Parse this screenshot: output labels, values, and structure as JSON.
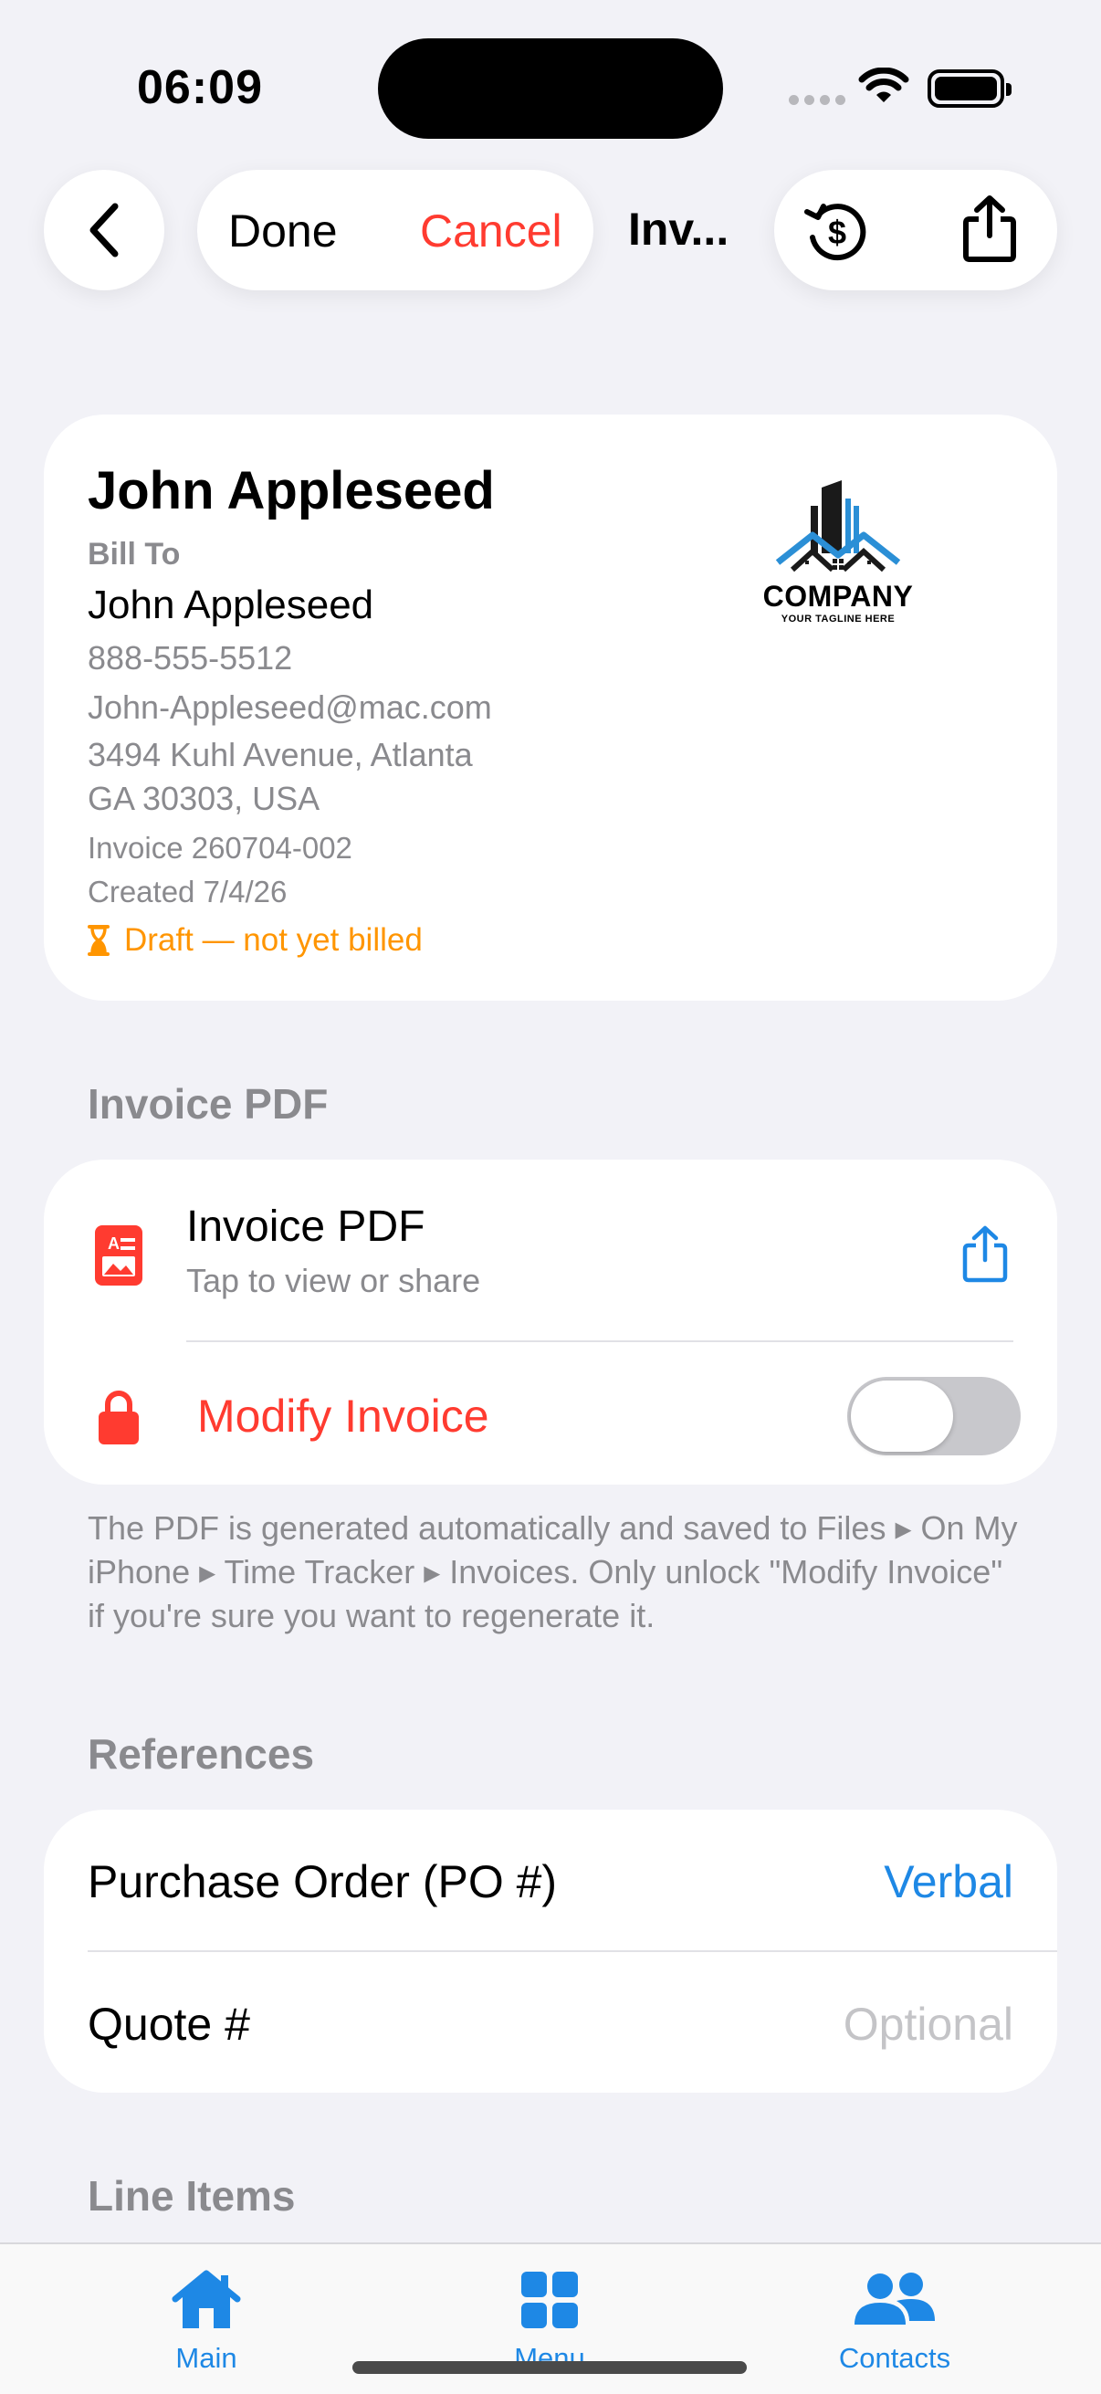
{
  "status_bar": {
    "time": "06:09"
  },
  "nav": {
    "done_label": "Done",
    "cancel_label": "Cancel",
    "title": "Inv..."
  },
  "client": {
    "name": "John Appleseed",
    "bill_to_label": "Bill To",
    "bill_to_name": "John Appleseed",
    "phone": "888-555-5512",
    "email": "John-Appleseed@mac.com",
    "address_line1": "3494 Kuhl Avenue, Atlanta",
    "address_line2": "GA 30303, USA",
    "invoice_number": "Invoice 260704-002",
    "created": "Created 7/4/26",
    "status": "Draft — not yet billed"
  },
  "logo": {
    "company": "COMPANY",
    "tagline": "YOUR TAGLINE HERE"
  },
  "pdf_section": {
    "header": "Invoice PDF",
    "row_title": "Invoice PDF",
    "row_subtitle": "Tap to view or share",
    "modify_label": "Modify Invoice",
    "modify_enabled": false,
    "footnote": "The PDF is generated automatically and saved to Files ▸ On My iPhone ▸ Time Tracker ▸ Invoices. Only unlock \"Modify Invoice\" if you're sure you want to regenerate it."
  },
  "references": {
    "header": "References",
    "po_label": "Purchase Order (PO #)",
    "po_value": "Verbal",
    "quote_label": "Quote #",
    "quote_placeholder": "Optional"
  },
  "line_items": {
    "header": "Line Items"
  },
  "tab_bar": {
    "tabs": [
      {
        "label": "Main",
        "icon": "house-icon"
      },
      {
        "label": "Menu",
        "icon": "grid-icon"
      },
      {
        "label": "Contacts",
        "icon": "people-icon"
      }
    ]
  },
  "colors": {
    "accent": "#1E88E5",
    "destructive": "#FF3B30",
    "warning": "#FF9500",
    "secondary_text": "#8A8A8E",
    "background": "#F2F2F7"
  }
}
